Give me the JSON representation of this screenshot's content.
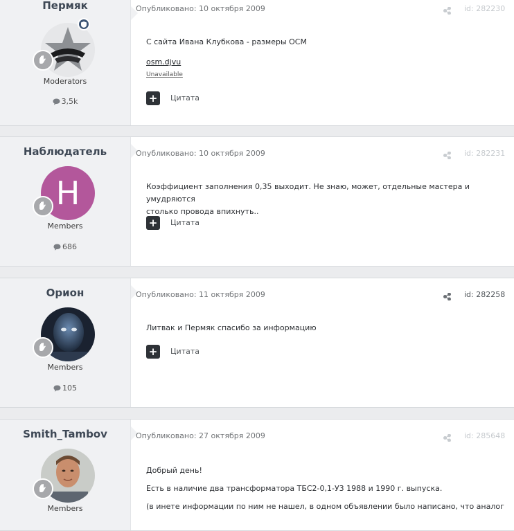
{
  "posts": [
    {
      "username": "Пермяк",
      "group": "Moderators",
      "post_count": "3,5k",
      "published": "Опубликовано: 10 октября 2009",
      "post_id": "id: 282230",
      "content": [
        "С сайта Ивана Клубкова - размеры ОСМ"
      ],
      "attachment": {
        "name": "osm.djvu",
        "status": "Unavailable"
      },
      "quote_label": "Цитата"
    },
    {
      "username": "Наблюдатель",
      "group": "Members",
      "post_count": "686",
      "avatar_letter": "Н",
      "published": "Опубликовано: 10 октября 2009",
      "post_id": "id: 282231",
      "content": [
        "Коэффициент заполнения 0,35 выходит. Не знаю, может, отдельные мастера и умудряются",
        "столько провода впихнуть.."
      ],
      "quote_label": "Цитата"
    },
    {
      "username": "Орион",
      "group": "Members",
      "post_count": "105",
      "published": "Опубликовано: 11 октября 2009",
      "post_id": "id: 282258",
      "content": [
        "Литвак и Пермяк спасибо за информацию"
      ],
      "quote_label": "Цитата"
    },
    {
      "username": "Smith_Tambov",
      "group": "Members",
      "published": "Опубликовано: 27 октября 2009",
      "post_id": "id: 285648",
      "content": [
        "Добрый день!",
        "Есть в наличие два трансформатора ТБС2-0,1-У3 1988 и 1990 г. выпуска.",
        "(в инете информации по ним не нашел, в одном объявлении было написано, что аналог"
      ]
    }
  ],
  "colors": {
    "avatar_letter_bg": "#b3579b",
    "badge_gray": "#a7a8ab",
    "moderator_badge": "#3d5575"
  }
}
